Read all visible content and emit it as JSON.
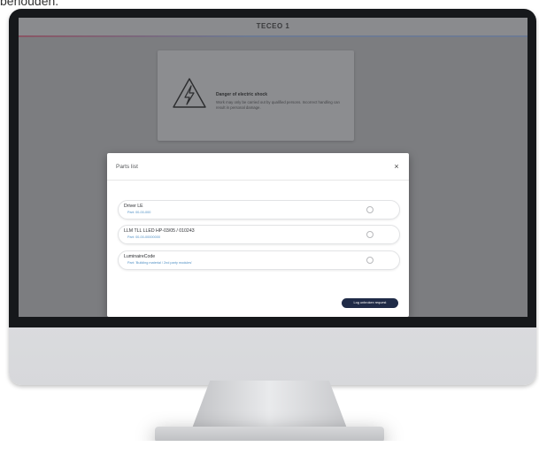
{
  "caption_fragment": "behouden.",
  "app": {
    "title": "TECEO 1"
  },
  "warning_card": {
    "title": "Danger of electric shock",
    "text": "Work may only be carried out by qualified persons. Incorrect handling can result in personal damage.",
    "icon": "electric-hazard-icon"
  },
  "dialog": {
    "title": "Parts list",
    "close_label": "×",
    "parts": [
      {
        "label": "Driver   LE",
        "sub": "Part: 00-00-000"
      },
      {
        "label": "LLM   TLL LLED HP-03/05 / 010243",
        "sub": "Part: 00-00-00000000"
      },
      {
        "label": "LuminaireCode",
        "sub": "Part: 'Building material / 2nd party modules'"
      }
    ],
    "primary_button": "Log unbroken request"
  },
  "colors": {
    "accent_dark_navy": "#1f2b47",
    "link_blue": "#4f8fc4"
  }
}
